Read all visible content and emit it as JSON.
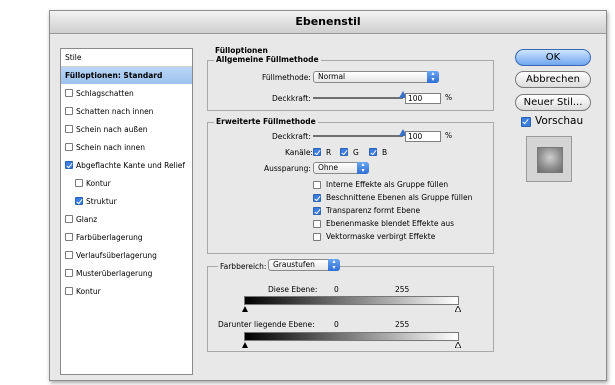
{
  "window": {
    "title": "Ebenenstil"
  },
  "sidebar": {
    "header": "Stile",
    "items": [
      {
        "label": "Fülloptionen: Standard",
        "selected": true,
        "checkbox": false,
        "checked": false
      },
      {
        "label": "Schlagschatten",
        "checkbox": true,
        "checked": false
      },
      {
        "label": "Schatten nach innen",
        "checkbox": true,
        "checked": false
      },
      {
        "label": "Schein nach außen",
        "checkbox": true,
        "checked": false
      },
      {
        "label": "Schein nach innen",
        "checkbox": true,
        "checked": false
      },
      {
        "label": "Abgeflachte Kante und Relief",
        "checkbox": true,
        "checked": true
      },
      {
        "label": "Kontur",
        "checkbox": true,
        "checked": false,
        "indent": true
      },
      {
        "label": "Struktur",
        "checkbox": true,
        "checked": true,
        "indent": true
      },
      {
        "label": "Glanz",
        "checkbox": true,
        "checked": false
      },
      {
        "label": "Farbüberlagerung",
        "checkbox": true,
        "checked": false
      },
      {
        "label": "Verlaufsüberlagerung",
        "checkbox": true,
        "checked": false
      },
      {
        "label": "Musterüberlagerung",
        "checkbox": true,
        "checked": false
      },
      {
        "label": "Kontur",
        "checkbox": true,
        "checked": false
      }
    ]
  },
  "main": {
    "section_title": "Fülloptionen",
    "general": {
      "title": "Allgemeine Füllmethode",
      "blend_label": "Füllmethode:",
      "blend_value": "Normal",
      "opacity_label": "Deckkraft:",
      "opacity_value": "100",
      "opacity_unit": "%",
      "opacity_fraction": 1.0
    },
    "advanced": {
      "title": "Erweiterte Füllmethode",
      "fill_opacity_label": "Deckkraft:",
      "fill_opacity_value": "100",
      "fill_opacity_unit": "%",
      "fill_opacity_fraction": 1.0,
      "channels_label": "Kanäle:",
      "channels": [
        {
          "label": "R",
          "checked": true
        },
        {
          "label": "G",
          "checked": true
        },
        {
          "label": "B",
          "checked": true
        }
      ],
      "knockout_label": "Aussparung:",
      "knockout_value": "Ohne",
      "options": [
        {
          "label": "Interne Effekte als Gruppe füllen",
          "checked": false
        },
        {
          "label": "Beschnittene Ebenen als Gruppe füllen",
          "checked": true
        },
        {
          "label": "Transparenz formt Ebene",
          "checked": true
        },
        {
          "label": "Ebenenmaske blendet Effekte aus",
          "checked": false
        },
        {
          "label": "Vektormaske verbirgt Effekte",
          "checked": false
        }
      ]
    },
    "blend_if": {
      "label": "Farbbereich:",
      "value": "Graustufen",
      "this_layer_label": "Diese Ebene:",
      "this_layer_min": "0",
      "this_layer_max": "255",
      "underlying_label": "Darunter liegende Ebene:",
      "underlying_min": "0",
      "underlying_max": "255"
    }
  },
  "buttons": {
    "ok": "OK",
    "cancel": "Abbrechen",
    "new_style": "Neuer Stil...",
    "preview_label": "Vorschau",
    "preview_checked": true
  }
}
